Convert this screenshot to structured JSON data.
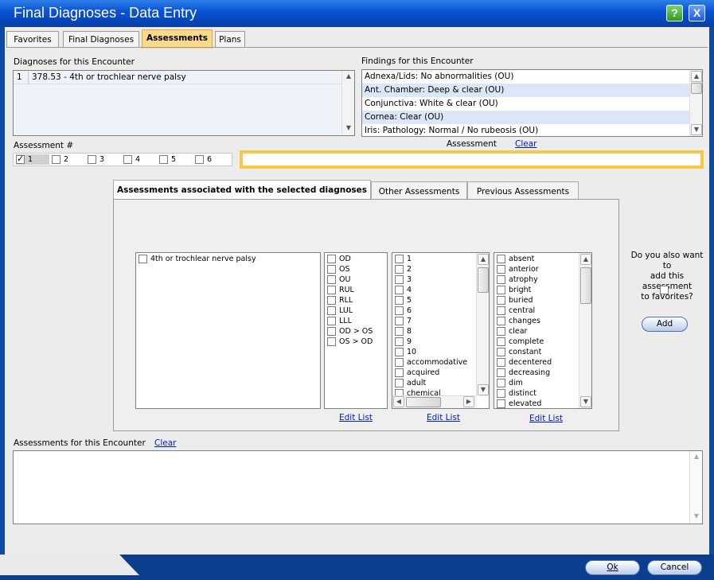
{
  "window": {
    "title": "Final Diagnoses - Data Entry",
    "help_label": "?",
    "close_label": "X"
  },
  "tabs": [
    {
      "label": "Favorites"
    },
    {
      "label": "Final Diagnoses"
    },
    {
      "label": "Assessments"
    },
    {
      "label": "Plans"
    }
  ],
  "diagnoses": {
    "label": "Diagnoses for this Encounter",
    "rows": [
      {
        "num": "1",
        "text": "378.53 - 4th or trochlear nerve palsy"
      }
    ]
  },
  "findings": {
    "label": "Findings for this Encounter",
    "items": [
      "Adnexa/Lids: No abnormalities (OU)",
      "Ant. Chamber: Deep & clear (OU)",
      "Conjunctiva: White & clear (OU)",
      "Cornea: Clear (OU)",
      "Iris: Pathology: Normal / No rubeosis (OU)"
    ]
  },
  "assessment_num": {
    "label": "Assessment #",
    "items": [
      "1",
      "2",
      "3",
      "4",
      "5",
      "6"
    ]
  },
  "assessment": {
    "label": "Assessment",
    "clear": "Clear",
    "value": ""
  },
  "panel": {
    "tabs": [
      "Assessments associated with the selected diagnoses",
      "Other Assessments",
      "Previous Assessments"
    ],
    "diag_list": [
      "4th or trochlear nerve palsy"
    ],
    "eye_list": [
      "OD",
      "OS",
      "OU",
      "RUL",
      "RLL",
      "LUL",
      "LLL",
      "OD > OS",
      "OS > OD"
    ],
    "num_list": [
      "1",
      "2",
      "3",
      "4",
      "5",
      "6",
      "7",
      "8",
      "9",
      "10",
      "accommodative",
      "acquired",
      "adult",
      "chemical"
    ],
    "desc_list": [
      "absent",
      "anterior",
      "atrophy",
      "bright",
      "buried",
      "central",
      "changes",
      "clear",
      "complete",
      "constant",
      "decentered",
      "decreasing",
      "dim",
      "distinct",
      "elevated"
    ],
    "edit_list": "Edit List"
  },
  "favorites": {
    "question": [
      "Do you also want to",
      "add this assessment",
      "to favorites?"
    ],
    "add_label": "Add"
  },
  "encounter_assessments": {
    "label": "Assessments for this Encounter",
    "clear": "Clear"
  },
  "footer": {
    "ok_label": "Ok",
    "cancel_label": "Cancel"
  },
  "colors": {
    "title_bar": "#0a54d4",
    "active_tab": "#fbd98a",
    "assessment_border": "#f7c847",
    "link": "#0018c8"
  }
}
